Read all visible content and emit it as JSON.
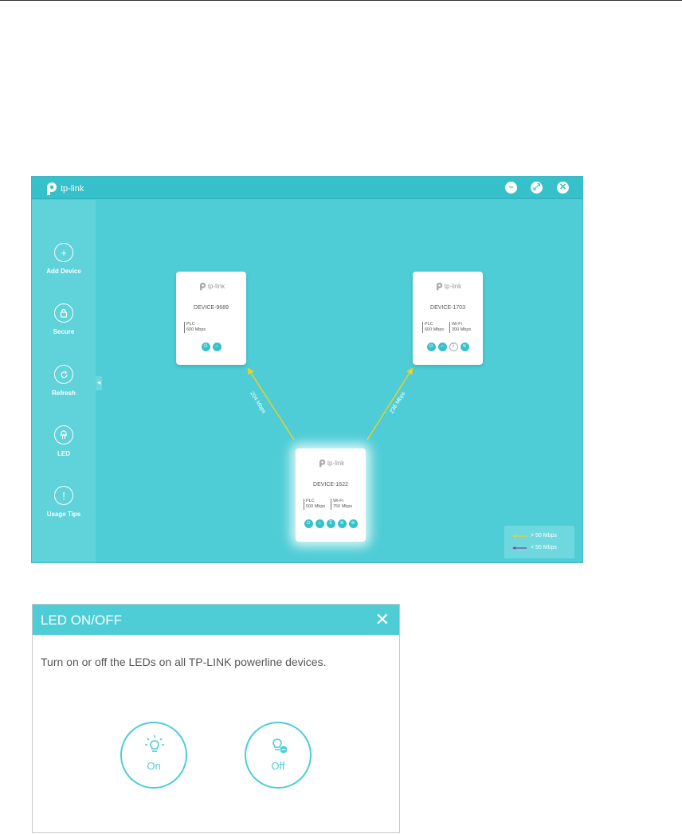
{
  "app": {
    "brand": "tp-link",
    "window_buttons": {
      "minimize_icon": "minimize-icon",
      "maximize_icon": "maximize-icon",
      "close_icon": "close-icon"
    },
    "sidebar": {
      "items": [
        {
          "label": "Add Device",
          "icon": "plus-icon"
        },
        {
          "label": "Secure",
          "icon": "lock-icon"
        },
        {
          "label": "Refresh",
          "icon": "refresh-icon"
        },
        {
          "label": "LED",
          "icon": "led-icon"
        },
        {
          "label": "Usage Tips",
          "icon": "exclamation-icon"
        }
      ]
    },
    "devices": [
      {
        "name": "DEVICE-9689",
        "spec1_label": "PLC",
        "spec1_value": "600 Mbps"
      },
      {
        "name": "DEVICE-1703",
        "spec1_label": "PLC",
        "spec1_value": "600 Mbps",
        "spec2_label": "Wi-Fi",
        "spec2_value": "300 Mbps"
      },
      {
        "name": "DEVICE-1622",
        "spec1_label": "PLC",
        "spec1_value": "500 Mbps",
        "spec2_label": "Wi-Fi",
        "spec2_value": "750 Mbps"
      }
    ],
    "links": [
      {
        "speed": "204 Mbps"
      },
      {
        "speed": "238 Mbps"
      }
    ],
    "legend": [
      {
        "text": "> 50 Mbps",
        "color": "#f0d020"
      },
      {
        "text": "< 50 Mbps",
        "color": "#8a3a9a"
      }
    ],
    "colors": {
      "accent": "#4ecdd6",
      "link_fast": "#f0d020",
      "link_slow": "#8a3a9a"
    }
  },
  "dialog": {
    "title": "LED ON/OFF",
    "message": "Turn on or off the LEDs on all TP-LINK powerline devices.",
    "on_label": "On",
    "off_label": "Off"
  }
}
